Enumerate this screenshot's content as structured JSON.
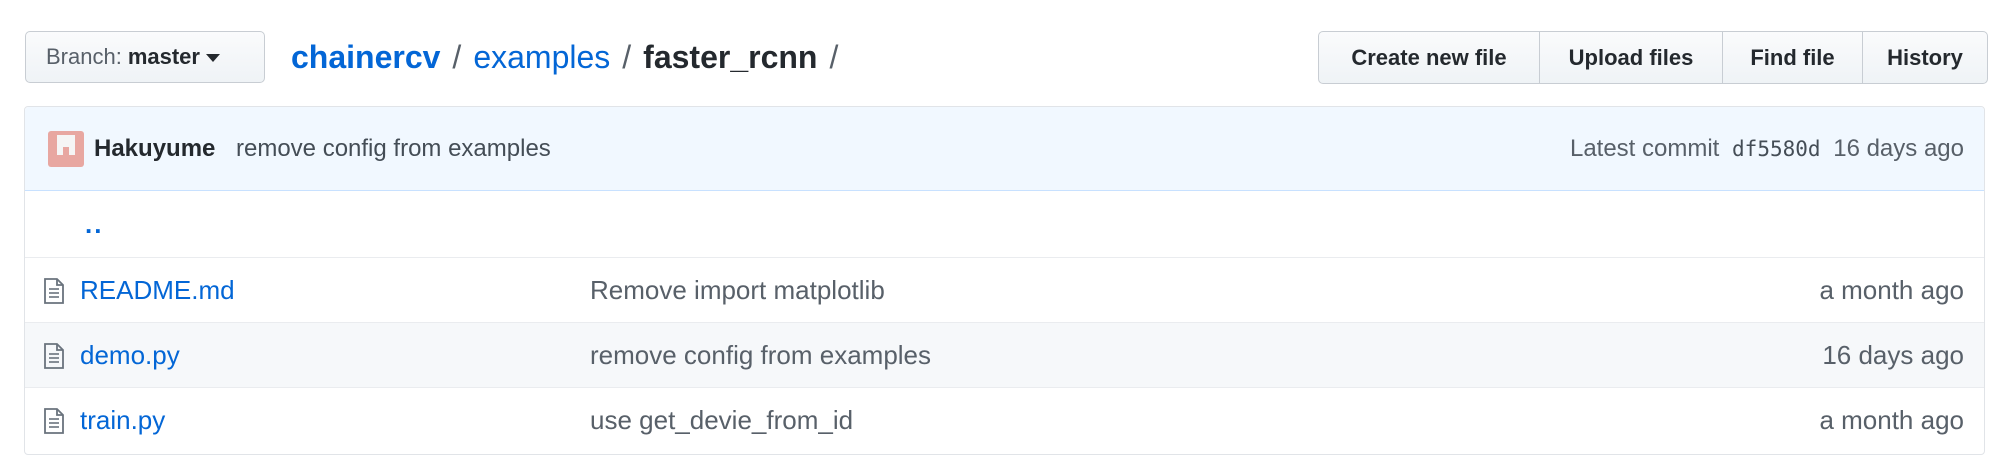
{
  "branch": {
    "prefix": "Branch:",
    "name": "master"
  },
  "breadcrumb": {
    "root": "chainercv",
    "separator": "/",
    "parent": "examples",
    "current": "faster_rcnn"
  },
  "actions": {
    "create_new_file": "Create new file",
    "upload_files": "Upload files",
    "find_file": "Find file",
    "history": "History"
  },
  "latest_commit": {
    "author": "Hakuyume",
    "message": "remove config from examples",
    "label": "Latest commit",
    "sha": "df5580d",
    "age": "16 days ago"
  },
  "parent_dir": {
    "label": ".."
  },
  "files": [
    {
      "name": "README.md",
      "message": "Remove import matplotlib",
      "age": "a month ago",
      "icon": "file-icon"
    },
    {
      "name": "demo.py",
      "message": "remove config from examples",
      "age": "16 days ago",
      "icon": "file-icon"
    },
    {
      "name": "train.py",
      "message": "use get_devie_from_id",
      "age": "a month ago",
      "icon": "file-icon"
    }
  ],
  "colors": {
    "link": "#0366d6",
    "commit_bar_bg": "#f1f8ff",
    "avatar": "#e8a7a1"
  }
}
